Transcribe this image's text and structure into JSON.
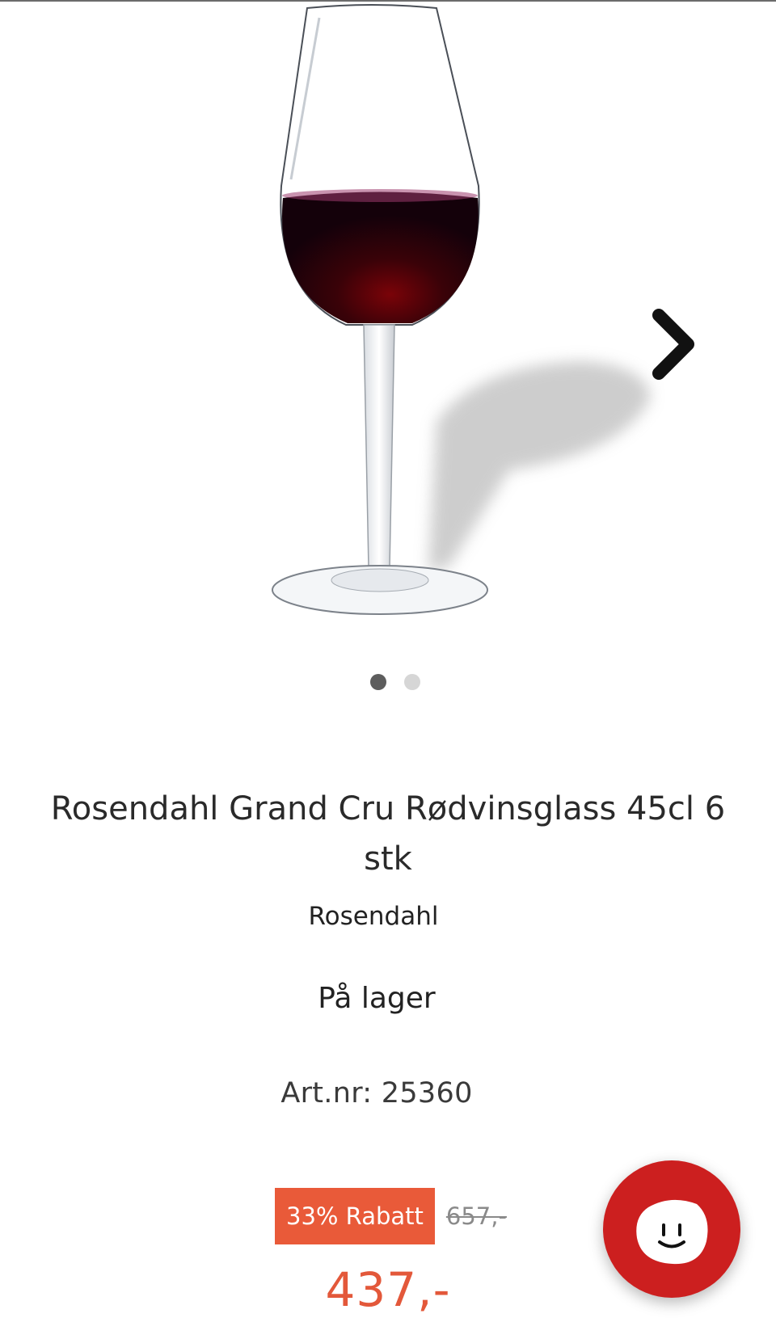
{
  "product": {
    "title": "Rosendahl Grand Cru Rødvinsglass 45cl 6 stk",
    "brand": "Rosendahl",
    "stock_status": "På lager",
    "article_number": "Art.nr: 25360"
  },
  "gallery": {
    "image_icon": "red-wine-glass",
    "next_icon": "chevron-right-icon",
    "slide_count": 2,
    "active_slide": 1
  },
  "pricing": {
    "discount_label": "33% Rabatt",
    "old_price": "657,-",
    "sale_price": "437,-",
    "accent_color": "#e95a39"
  },
  "chat": {
    "icon": "smiley-chat-icon",
    "color": "#cc1f1f"
  }
}
